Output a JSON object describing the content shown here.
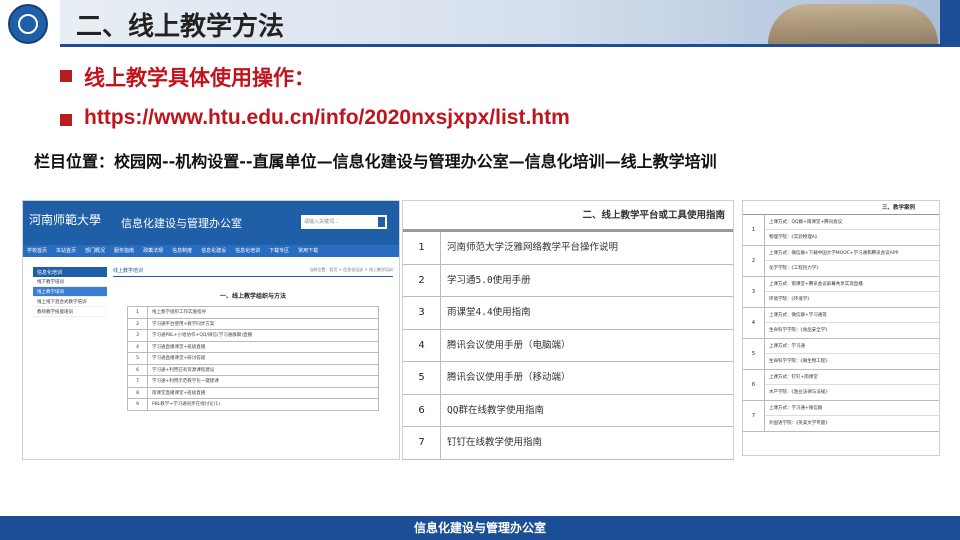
{
  "header": {
    "title": "二、线上教学方法"
  },
  "bullets": {
    "heading": "线上教学具体使用操作：",
    "url": "https://www.htu.edu.cn/info/2020nxsjxpx/list.htm"
  },
  "location": "栏目位置：校园网--机构设置--直属单位—信息化建设与管理办公室—信息化培训—线上教学培训",
  "web": {
    "logo_text": "河南师範大學",
    "site_name": "信息化建设与管理办公室",
    "search_placeholder": "请输入关键词...",
    "nav": [
      "学校首页",
      "本站首页",
      "部门概况",
      "服务指南",
      "政策法规",
      "信息制度",
      "信息化建设",
      "信息化培训",
      "下载专区",
      "常用下载"
    ],
    "side_header": "信息化培训",
    "side_items": [
      "线下教学培训",
      "线上教学培训",
      "线上线下混合式教学培训",
      "教师教学技能培训"
    ],
    "main_header": "线上教学培训",
    "breadcrumb": "当前位置：首页 > 信息化培训 > 线上教学培训",
    "main_title": "一、线上教学组织与方法",
    "rows": [
      {
        "n": "1",
        "t": "线上教学组织工作实施指导"
      },
      {
        "n": "2",
        "t": "学习通平台使用+教学同步方案"
      },
      {
        "n": "3",
        "t": "学习通PBL+小组协作+QQ/微信(学习通群聊)直播"
      },
      {
        "n": "4",
        "t": "学习通直播课堂+班级直播"
      },
      {
        "n": "5",
        "t": "学习通直播课堂+研讨答疑"
      },
      {
        "n": "6",
        "t": "学习通+利用已有资源课程建设"
      },
      {
        "n": "7",
        "t": "学习通+利用示范教学包一键建课"
      },
      {
        "n": "8",
        "t": "雨课堂直播课堂+班级直播"
      },
      {
        "n": "9",
        "t": "PBL教学+学习通同步在线讨论(1)"
      }
    ]
  },
  "guide": {
    "title": "二、线上教学平台或工具使用指南",
    "rows": [
      {
        "n": "1",
        "t": "河南师范大学泛雅网络教学平台操作说明"
      },
      {
        "n": "2",
        "t": "学习通5.0使用手册"
      },
      {
        "n": "3",
        "t": "雨课堂4.4使用指南"
      },
      {
        "n": "4",
        "t": "腾讯会议使用手册（电脑端）"
      },
      {
        "n": "5",
        "t": "腾讯会议使用手册（移动端）"
      },
      {
        "n": "6",
        "t": "QQ群在线教学使用指南"
      },
      {
        "n": "7",
        "t": "钉钉在线教学使用指南"
      }
    ]
  },
  "cases": {
    "title": "三、教学案例",
    "groups": [
      {
        "n": "1",
        "lines": [
          "上课方式：QQ群+雨课堂+腾讯会议",
          "物理学院：《实验物理A》"
        ]
      },
      {
        "n": "2",
        "lines": [
          "上课方式：微信群+下载中国大学MOOC+学习通和腾讯会议APP",
          "化学学院：《工程热力学》"
        ]
      },
      {
        "n": "3",
        "lines": [
          "上课方式：雨课堂+腾讯会议屏幕共享实现直播",
          "环境学院：《环境学》"
        ]
      },
      {
        "n": "4",
        "lines": [
          "上课方式：微信群+学习通等",
          "生命科学学院：《食品安全学》"
        ]
      },
      {
        "n": "5",
        "lines": [
          "上课方式：学习通",
          "生命科学学院：《微生物工程》"
        ]
      },
      {
        "n": "6",
        "lines": [
          "上课方式：钉钉+雨课堂",
          "水产学院：《渔业法律与法规》"
        ]
      },
      {
        "n": "7",
        "lines": [
          "上课方式：学习通+微信群",
          "外国语学院：《英美文学专题》"
        ]
      }
    ]
  },
  "footer": {
    "text": "信息化建设与管理办公室"
  }
}
